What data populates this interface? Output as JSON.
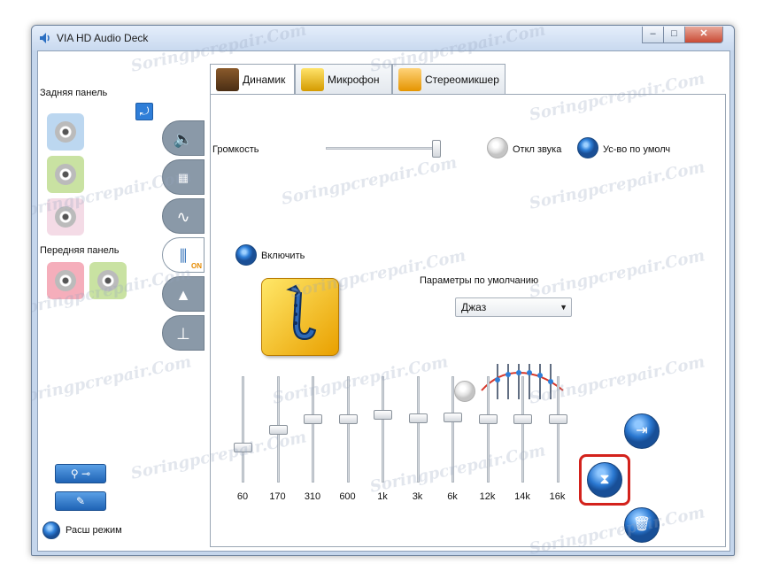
{
  "window": {
    "title": "VIA HD Audio Deck",
    "controls": {
      "minimize": "–",
      "maximize": "□",
      "close": "✕"
    }
  },
  "sidebar": {
    "rear_panel_label": "Задняя панель",
    "front_panel_label": "Передняя панель",
    "rear_jacks": [
      {
        "color": "#bcd7f0",
        "name": "blue jack"
      },
      {
        "color": "#c9e2a2",
        "name": "green jack"
      },
      {
        "color": "#f4dbe6",
        "name": "pink jack"
      }
    ],
    "front_jacks": [
      {
        "color": "#f5aebb",
        "name": "pink jack"
      },
      {
        "color": "#c9e2a2",
        "name": "green jack"
      }
    ],
    "vtabs": [
      "volume",
      "speakers",
      "waveform",
      "equalizer",
      "environment",
      "room-correction"
    ],
    "equalizer_on_badge": "ON",
    "advanced_mode_label": "Расш режим"
  },
  "tabs": [
    {
      "label": "Динамик",
      "active": true
    },
    {
      "label": "Микрофон",
      "active": false
    },
    {
      "label": "Стереомикшер",
      "active": false
    }
  ],
  "speaker": {
    "volume_label": "Громкость",
    "volume_value": 1.0,
    "mute_label": "Откл звука",
    "default_device_label": "Ус-во по умолч",
    "enable_label": "Включить",
    "preset_label": "Параметры по умолчанию",
    "preset_value": "Джаз",
    "eq_bands": [
      {
        "freq": "60",
        "level": 0.33
      },
      {
        "freq": "170",
        "level": 0.5
      },
      {
        "freq": "310",
        "level": 0.6
      },
      {
        "freq": "600",
        "level": 0.6
      },
      {
        "freq": "1k",
        "level": 0.64
      },
      {
        "freq": "3k",
        "level": 0.61
      },
      {
        "freq": "6k",
        "level": 0.62
      },
      {
        "freq": "12k",
        "level": 0.6
      },
      {
        "freq": "14k",
        "level": 0.6
      },
      {
        "freq": "16k",
        "level": 0.6
      }
    ]
  },
  "watermark": "Soringpcrepair.Com",
  "colors": {
    "accent": "#2e7fd8",
    "highlight": "#d3221c"
  }
}
